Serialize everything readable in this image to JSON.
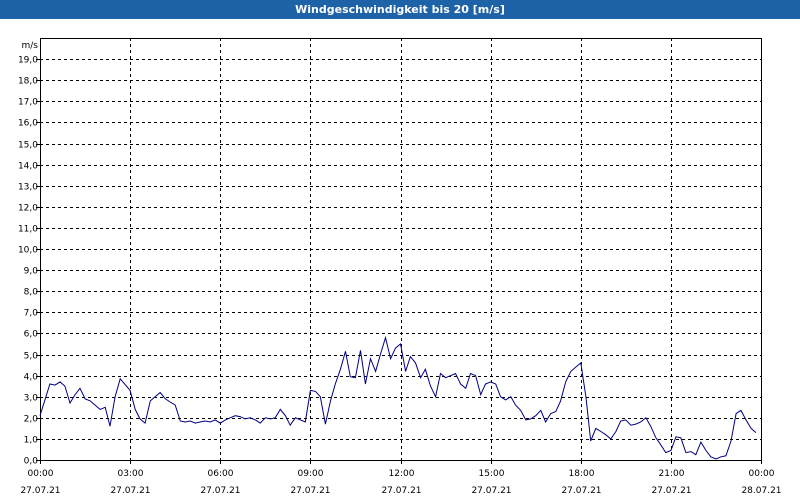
{
  "window": {
    "title": "Windgeschwindigkeit bis 20 [m/s]"
  },
  "chart_data": {
    "type": "line",
    "title": "Windgeschwindigkeit bis 20 [m/s]",
    "ylabel": "m/s",
    "ylim": [
      0,
      20
    ],
    "xlim_hours": [
      0,
      24
    ],
    "y_ticks": [
      "0,0",
      "1,0",
      "2,0",
      "3,0",
      "4,0",
      "5,0",
      "6,0",
      "7,0",
      "8,0",
      "9,0",
      "10,0",
      "11,0",
      "12,0",
      "13,0",
      "14,0",
      "15,0",
      "16,0",
      "17,0",
      "18,0",
      "19,0"
    ],
    "x_ticks": [
      {
        "time": "00:00",
        "date": "27.07.21"
      },
      {
        "time": "03:00",
        "date": "27.07.21"
      },
      {
        "time": "06:00",
        "date": "27.07.21"
      },
      {
        "time": "09:00",
        "date": "27.07.21"
      },
      {
        "time": "12:00",
        "date": "27.07.21"
      },
      {
        "time": "15:00",
        "date": "27.07.21"
      },
      {
        "time": "18:00",
        "date": "27.07.21"
      },
      {
        "time": "21:00",
        "date": "27.07.21"
      },
      {
        "time": "00:00",
        "date": "28.07.21"
      }
    ],
    "grid": true,
    "series": [
      {
        "color": "#000080",
        "x": [
          0.0,
          0.33,
          0.5,
          0.67,
          0.83,
          1.0,
          1.17,
          1.33,
          1.5,
          1.67,
          2.0,
          2.17,
          2.33,
          2.5,
          2.67,
          3.0,
          3.17,
          3.33,
          3.5,
          3.67,
          3.83,
          4.0,
          4.17,
          4.33,
          4.5,
          4.67,
          4.83,
          5.0,
          5.17,
          5.33,
          5.5,
          5.67,
          5.83,
          6.0,
          6.17,
          6.33,
          6.5,
          6.67,
          6.83,
          7.0,
          7.17,
          7.33,
          7.5,
          7.67,
          7.83,
          8.0,
          8.17,
          8.33,
          8.5,
          8.67,
          8.83,
          9.0,
          9.17,
          9.33,
          9.5,
          9.67,
          9.83,
          10.0,
          10.17,
          10.33,
          10.5,
          10.67,
          10.83,
          11.0,
          11.17,
          11.33,
          11.5,
          11.67,
          11.83,
          12.0,
          12.17,
          12.33,
          12.5,
          12.67,
          12.83,
          13.0,
          13.17,
          13.33,
          13.5,
          13.67,
          13.83,
          14.0,
          14.17,
          14.33,
          14.5,
          14.67,
          14.83,
          15.0,
          15.17,
          15.33,
          15.5,
          15.67,
          15.83,
          16.0,
          16.17,
          16.33,
          16.5,
          16.67,
          16.83,
          17.0,
          17.17,
          17.33,
          17.5,
          17.67,
          17.83,
          18.0,
          18.17,
          18.33,
          18.5,
          18.67,
          18.83,
          19.0,
          19.17,
          19.33,
          19.5,
          19.67,
          19.83,
          20.0,
          20.17,
          20.33,
          20.5,
          20.67,
          20.83,
          21.0,
          21.17,
          21.33,
          21.5,
          21.67,
          21.83,
          22.0,
          22.17,
          22.33,
          22.5,
          22.67,
          22.83,
          23.0,
          23.17,
          23.33,
          23.5,
          23.67,
          23.83
        ],
        "values": [
          2.1,
          3.6,
          3.55,
          3.7,
          3.5,
          2.7,
          3.1,
          3.4,
          2.9,
          2.8,
          2.4,
          2.5,
          1.6,
          3.0,
          3.85,
          3.3,
          2.4,
          1.95,
          1.75,
          2.8,
          3.0,
          3.2,
          2.9,
          2.75,
          2.6,
          1.85,
          1.8,
          1.85,
          1.75,
          1.8,
          1.85,
          1.8,
          1.9,
          1.75,
          1.9,
          2.0,
          2.1,
          2.05,
          1.95,
          2.0,
          1.9,
          1.75,
          2.0,
          1.95,
          2.0,
          2.4,
          2.1,
          1.65,
          2.0,
          1.9,
          1.8,
          3.3,
          3.25,
          3.0,
          1.7,
          2.8,
          3.6,
          4.3,
          5.15,
          3.95,
          3.9,
          5.2,
          3.6,
          4.8,
          4.2,
          5.0,
          5.8,
          4.8,
          5.3,
          5.5,
          4.2,
          4.9,
          4.6,
          3.9,
          4.3,
          3.5,
          3.0,
          4.1,
          3.9,
          4.0,
          4.1,
          3.6,
          3.4,
          4.1,
          4.0,
          3.1,
          3.6,
          3.7,
          3.6,
          3.0,
          2.85,
          3.0,
          2.6,
          2.35,
          1.9,
          1.95,
          2.1,
          2.35,
          1.8,
          2.2,
          2.3,
          2.8,
          3.7,
          4.2,
          4.4,
          4.6,
          3.0,
          0.9,
          1.5,
          1.35,
          1.2,
          1.0,
          1.35,
          1.85,
          1.9,
          1.65,
          1.7,
          1.8,
          2.0,
          1.6,
          1.05,
          0.7,
          0.35,
          0.45,
          1.1,
          1.05,
          0.35,
          0.4,
          0.25,
          0.85,
          0.45,
          0.15,
          0.05,
          0.15,
          0.2,
          0.9,
          2.2,
          2.35,
          1.9,
          1.5,
          1.3
        ]
      }
    ]
  }
}
